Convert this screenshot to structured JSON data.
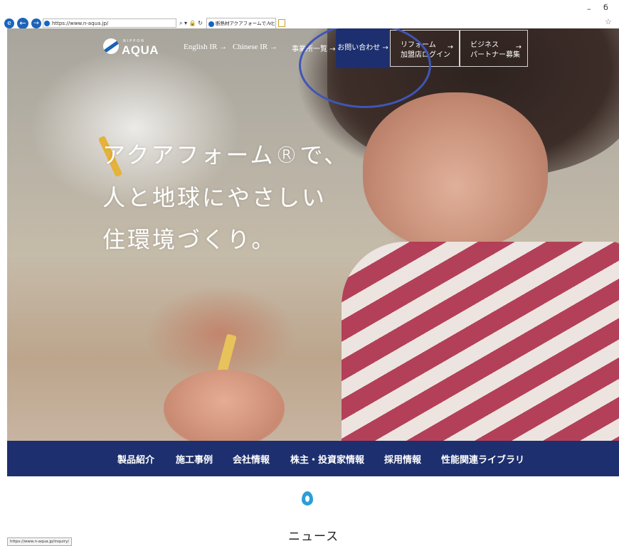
{
  "browser": {
    "address_url": "https://www.n-aqua.jp/",
    "address_tools": "⌕ ▾ 🔒 ↻",
    "tab_title": "断熱材アクアフォームで人と地...",
    "tab_close": "×",
    "window_min": "–",
    "window_max": "б",
    "favorites_icon": "☆",
    "status_url": "https://www.n-aqua.jp/inquiry/"
  },
  "header": {
    "logo_small": "NIPPON",
    "logo_main": "AQUA",
    "links": {
      "english_ir": "English IR →",
      "chinese_ir": "Chinese IR →",
      "offices": "事業所一覧 →",
      "contact": "お問い合わせ →"
    },
    "reform_button": {
      "line1": "リフォーム",
      "line2": "加盟店ログイン",
      "arrow": "→"
    },
    "partner_button": {
      "line1": "ビジネス",
      "line2": "パートナー募集",
      "arrow": "→"
    }
  },
  "hero": {
    "line1": "アクアフォーム®で、",
    "line2": "人と地球にやさしい",
    "line3": "住環境づくり。"
  },
  "main_nav": [
    "製品紹介",
    "施工事例",
    "会社情報",
    "株主・投資家情報",
    "採用情報",
    "性能関連ライブラリ"
  ],
  "news": {
    "title": "ニュース"
  },
  "colors": {
    "brand_navy": "#1d2f6e",
    "brand_blue": "#1a63b5",
    "drop_blue": "#2a9fd6",
    "highlight": "#3f56b8"
  }
}
